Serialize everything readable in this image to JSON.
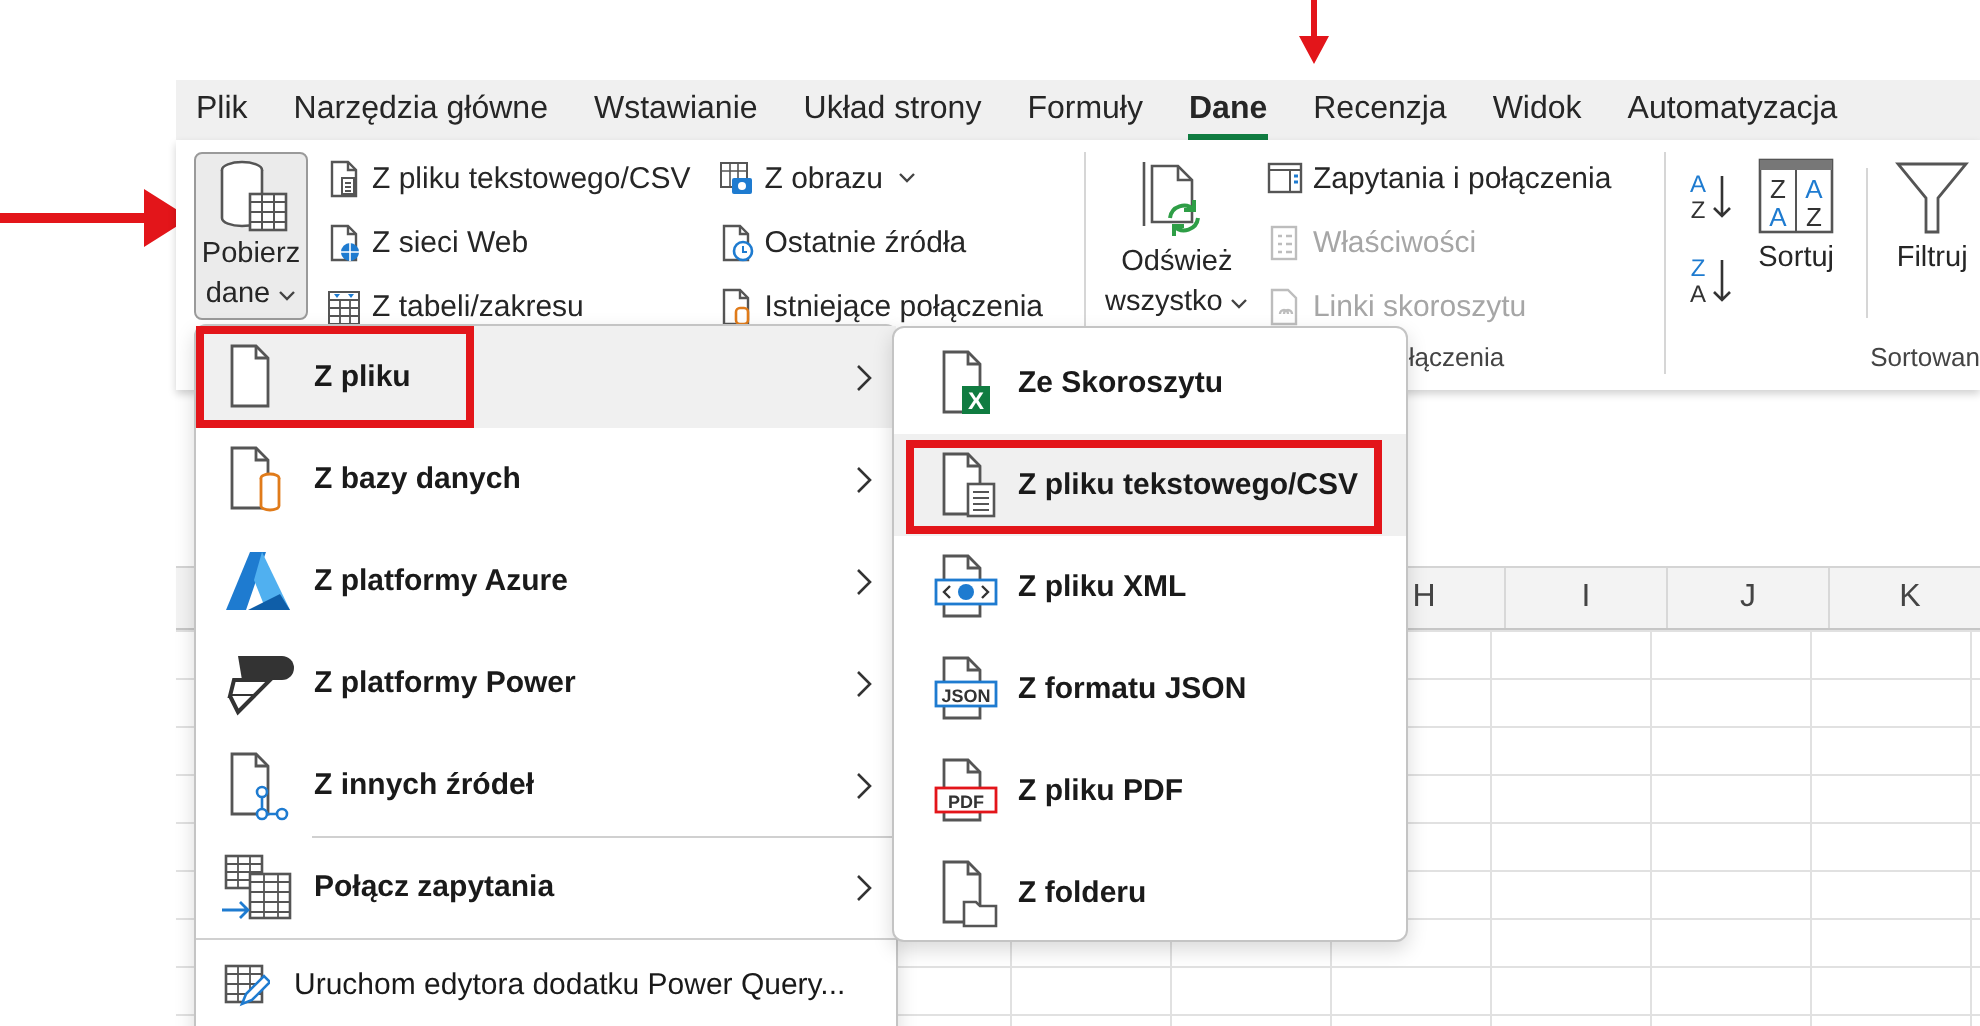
{
  "tabs": [
    {
      "label": "Plik",
      "selected": false
    },
    {
      "label": "Narzędzia główne",
      "selected": false
    },
    {
      "label": "Wstawianie",
      "selected": false
    },
    {
      "label": "Układ strony",
      "selected": false
    },
    {
      "label": "Formuły",
      "selected": false
    },
    {
      "label": "Dane",
      "selected": true
    },
    {
      "label": "Recenzja",
      "selected": false
    },
    {
      "label": "Widok",
      "selected": false
    },
    {
      "label": "Automatyzacja",
      "selected": false
    }
  ],
  "ribbon": {
    "get_data_button": {
      "label": "Pobierz dane",
      "pressed": true
    },
    "import_columns": [
      [
        {
          "label": "Z pliku tekstowego/CSV",
          "dropdown": false
        },
        {
          "label": "Z sieci Web",
          "dropdown": false
        },
        {
          "label": "Z tabeli/zakresu",
          "dropdown": false
        }
      ],
      [
        {
          "label": "Z obrazu",
          "dropdown": true
        },
        {
          "label": "Ostatnie źródła",
          "dropdown": false
        },
        {
          "label": "Istniejące połączenia",
          "dropdown": false
        }
      ]
    ],
    "refresh_button": {
      "label": "Odśwież wszystko"
    },
    "connections_items": [
      {
        "label": "Zapytania i połączenia",
        "disabled": false
      },
      {
        "label": "Właściwości",
        "disabled": true
      },
      {
        "label": "Linki skoroszytu",
        "disabled": true
      }
    ],
    "connections_group_label": "łączenia",
    "sort_ascending": {
      "top": "A",
      "bottom": "Z"
    },
    "sort_descending": {
      "top": "Z",
      "bottom": "A"
    },
    "sort_button": {
      "label": "Sortuj",
      "letters": [
        "Z",
        "A",
        "A",
        "Z"
      ]
    },
    "filter_button": {
      "label": "Filtruj"
    },
    "sort_group_label": "Sortowan"
  },
  "menu": {
    "items": [
      {
        "kind": "submenu",
        "label": "Z pliku",
        "selected": true,
        "marked": true,
        "separator_before": false
      },
      {
        "kind": "submenu",
        "label": "Z bazy danych",
        "selected": false,
        "marked": false,
        "separator_before": false
      },
      {
        "kind": "submenu",
        "label": "Z platformy Azure",
        "selected": false,
        "marked": false,
        "separator_before": false
      },
      {
        "kind": "submenu",
        "label": "Z platformy Power",
        "selected": false,
        "marked": false,
        "separator_before": false
      },
      {
        "kind": "submenu",
        "label": "Z innych źródeł",
        "selected": false,
        "marked": false,
        "separator_before": false
      },
      {
        "kind": "submenu",
        "label": "Połącz zapytania",
        "selected": false,
        "marked": false,
        "separator_before": true
      },
      {
        "kind": "command",
        "label": "Uruchom edytora dodatku Power Query...",
        "selected": false,
        "marked": false,
        "separator_before": true
      }
    ]
  },
  "submenu": {
    "items": [
      {
        "label": "Ze Skoroszytu",
        "selected": false,
        "marked": false,
        "icon_text": "X"
      },
      {
        "label": "Z pliku tekstowego/CSV",
        "selected": true,
        "marked": true
      },
      {
        "label": "Z pliku XML",
        "selected": false,
        "marked": false
      },
      {
        "label": "Z formatu JSON",
        "selected": false,
        "marked": false,
        "icon_text": "JSON"
      },
      {
        "label": "Z pliku PDF",
        "selected": false,
        "marked": false,
        "icon_text": "PDF"
      },
      {
        "label": "Z folderu",
        "selected": false,
        "marked": false
      }
    ]
  },
  "sheet": {
    "columns": [
      "H",
      "I",
      "J",
      "K"
    ]
  }
}
